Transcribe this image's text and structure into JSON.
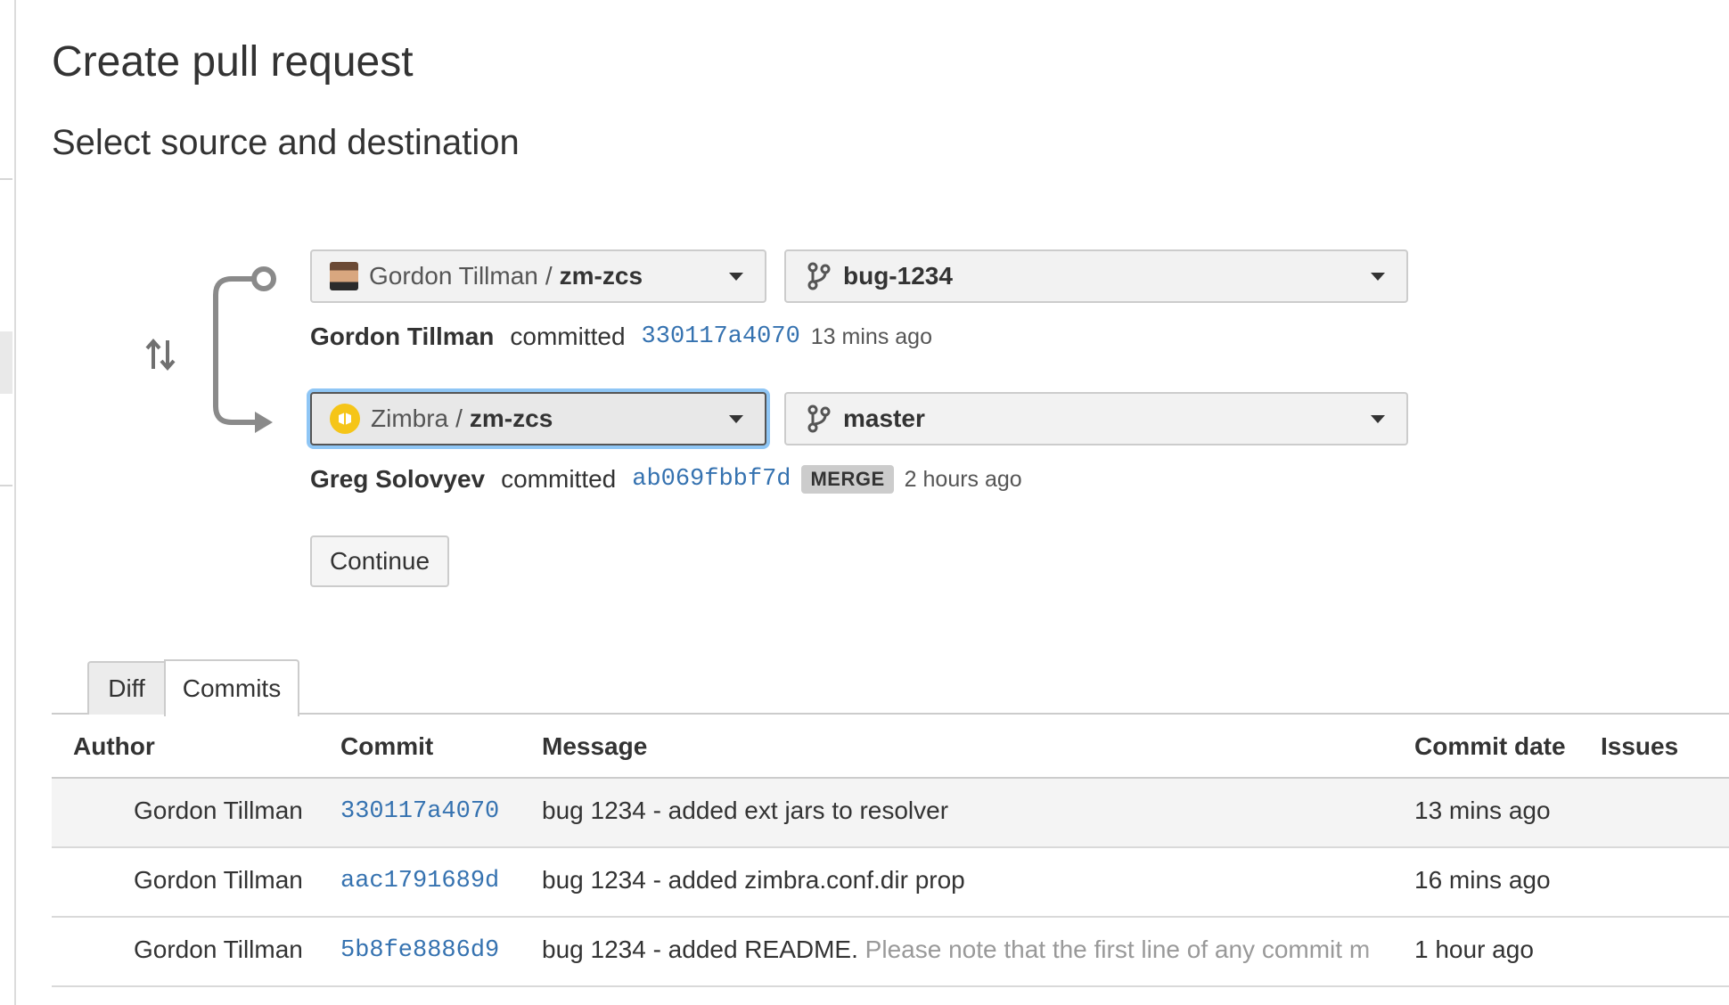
{
  "page": {
    "title": "Create pull request",
    "subtitle": "Select source and destination"
  },
  "source": {
    "repo_owner": "Gordon Tillman",
    "repo_name": "zm-zcs",
    "branch": "bug-1234",
    "commit": {
      "author": "Gordon Tillman",
      "verb": "committed",
      "hash": "330117a4070",
      "time": "13 mins ago"
    }
  },
  "destination": {
    "repo_owner": "Zimbra",
    "repo_name": "zm-zcs",
    "branch": "master",
    "commit": {
      "author": "Greg Solovyev",
      "verb": "committed",
      "hash": "ab069fbbf7d",
      "badge": "MERGE",
      "time": "2 hours ago"
    }
  },
  "separator": "/",
  "continue_label": "Continue",
  "tabs": [
    {
      "label": "Diff",
      "active": false
    },
    {
      "label": "Commits",
      "active": true
    }
  ],
  "table": {
    "headers": {
      "author": "Author",
      "commit": "Commit",
      "message": "Message",
      "date": "Commit date",
      "issues": "Issues"
    },
    "rows": [
      {
        "author": "Gordon Tillman",
        "hash": "330117a4070",
        "message": "bug 1234 - added ext jars to resolver",
        "message_extra": "",
        "date": "13 mins ago"
      },
      {
        "author": "Gordon Tillman",
        "hash": "aac1791689d",
        "message": "bug 1234 - added zimbra.conf.dir prop",
        "message_extra": "",
        "date": "16 mins ago"
      },
      {
        "author": "Gordon Tillman",
        "hash": "5b8fe8886d9",
        "message": "bug 1234 - added README.",
        "message_extra": " Please note that the first line of any commit m",
        "date": "1 hour ago"
      }
    ]
  },
  "colors": {
    "link": "#3572b0",
    "focus_ring": "#8fc6f5",
    "zimbra_avatar": "#f5c518"
  }
}
